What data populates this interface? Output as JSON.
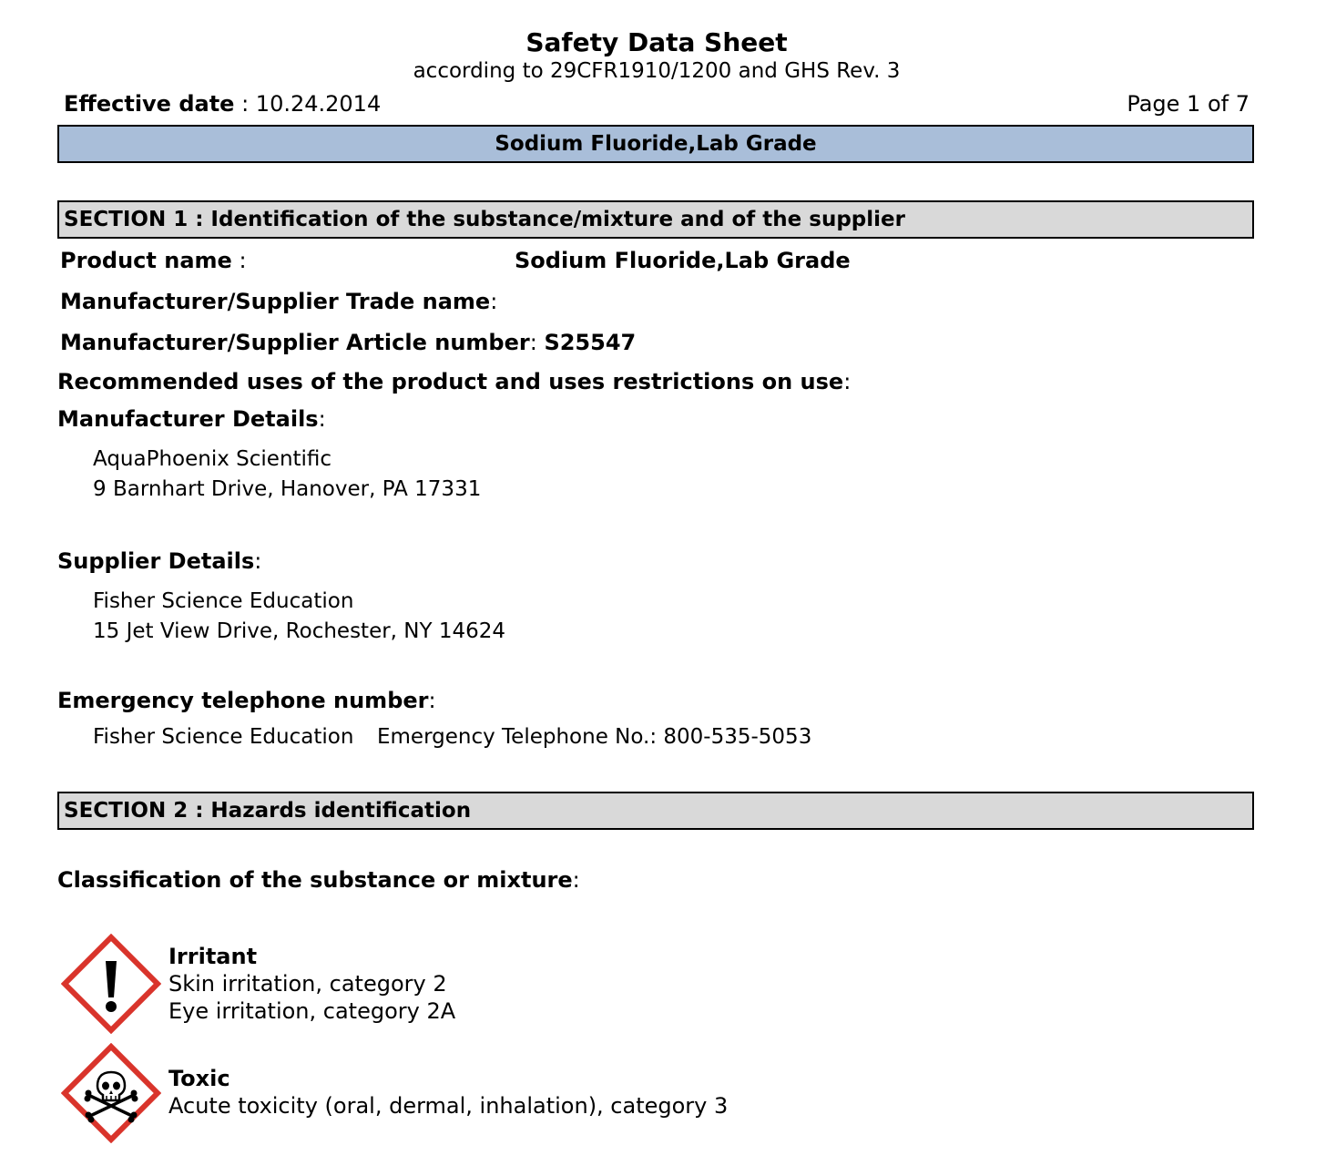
{
  "header": {
    "title": "Safety Data Sheet",
    "subtitle": "according to 29CFR1910/1200 and GHS Rev. 3",
    "effective_label": "Effective date",
    "effective_sep": " : ",
    "effective_value": "10.24.2014",
    "page": "Page 1 of 7",
    "product_banner": "Sodium Fluoride,Lab Grade"
  },
  "section1": {
    "heading": "SECTION 1 : Identification of the substance/mixture and of the supplier",
    "product_name_label": "Product name",
    "product_name_sep": " :",
    "product_name_value": "Sodium Fluoride,Lab Grade",
    "trade_name_label": "Manufacturer/Supplier Trade name",
    "trade_name_sep": ":",
    "article_label": "Manufacturer/Supplier Article number",
    "article_sep": ": ",
    "article_value": "S25547",
    "uses_label": "Recommended uses of the product and uses restrictions on use",
    "uses_sep": ":",
    "manufacturer_label": "Manufacturer Details",
    "manufacturer_sep": ":",
    "manufacturer_name": "AquaPhoenix Scientific",
    "manufacturer_address": "9 Barnhart Drive, Hanover, PA 17331",
    "supplier_label": "Supplier Details",
    "supplier_sep": ":",
    "supplier_name": "Fisher Science Education",
    "supplier_address": "15 Jet View Drive, Rochester, NY 14624",
    "emergency_label": "Emergency telephone number",
    "emergency_sep": ":",
    "emergency_name": "Fisher Science Education",
    "emergency_phone": "Emergency Telephone No.: 800-535-5053"
  },
  "section2": {
    "heading": "SECTION 2 : Hazards identification",
    "classification_label": "Classification of the substance or mixture",
    "classification_sep": ":",
    "hazards": [
      {
        "icon": "exclamation-mark-pictogram",
        "title": "Irritant",
        "lines": [
          "Skin irritation, category 2",
          "Eye irritation, category 2A"
        ]
      },
      {
        "icon": "skull-crossbones-pictogram",
        "title": "Toxic",
        "lines": [
          "Acute toxicity (oral, dermal, inhalation), category 3"
        ]
      }
    ]
  },
  "colors": {
    "product_banner_bg": "#a9bed9",
    "section_banner_bg": "#d9d9d9",
    "pictogram_border": "#d9342b"
  }
}
